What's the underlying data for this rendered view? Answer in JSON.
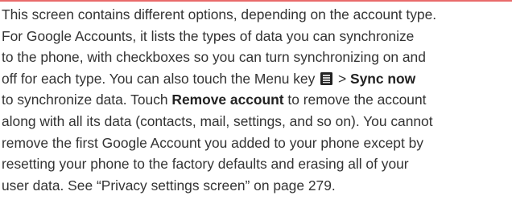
{
  "doc": {
    "lines": [
      {
        "text": "This screen contains different options, depending on the account type."
      },
      {
        "text": "For Google Accounts, it lists the types of data you can synchronize"
      },
      {
        "text": "to the phone, with checkboxes so you can turn synchronizing on and"
      },
      {
        "pre": "off for each type. You can also touch the Menu key ",
        "icon": "menu-key-icon",
        "mid": " > ",
        "bold": "Sync now"
      },
      {
        "pre": "to synchronize data. Touch ",
        "bold": "Remove account",
        "post": " to remove the account"
      },
      {
        "text": "along with all its data (contacts, mail, settings, and so on). You cannot"
      },
      {
        "text": "remove the first Google Account you added to your phone except by"
      },
      {
        "text": "resetting your phone to the factory defaults and erasing all of your"
      },
      {
        "text": "user data. See “Privacy settings screen” on page 279."
      }
    ]
  },
  "colors": {
    "rule": "#e96a6a",
    "text": "#333333",
    "icon": "#222222"
  }
}
